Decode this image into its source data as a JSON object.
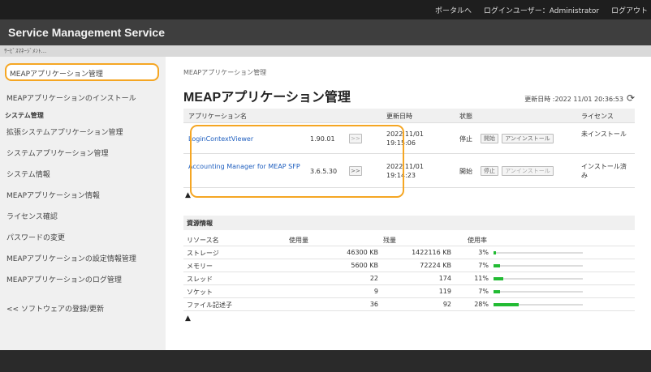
{
  "topbar": {
    "portal_link": "ポータルへ",
    "login_user": "ログインユーザー：Administrator",
    "logout": "ログアウト"
  },
  "header": {
    "app_title": "Service Management Service"
  },
  "crumbbar": {
    "text": "ｻｰﾋﾞｽﾏﾈｰｼﾞﾒﾝﾄ..."
  },
  "sidebar": {
    "items": [
      {
        "label": "MEAPアプリケーション管理"
      },
      {
        "label": "MEAPアプリケーションのインストール"
      },
      {
        "label": "拡張システムアプリケーション管理"
      },
      {
        "label": "システムアプリケーション管理"
      },
      {
        "label": "システム情報"
      },
      {
        "label": "MEAPアプリケーション情報"
      },
      {
        "label": "ライセンス確認"
      },
      {
        "label": "パスワードの変更"
      },
      {
        "label": "MEAPアプリケーションの設定情報管理"
      },
      {
        "label": "MEAPアプリケーションのログ管理"
      },
      {
        "label": "<< ソフトウェアの登録/更新"
      }
    ],
    "section_system": "システム管理"
  },
  "main": {
    "breadcrumb": "MEAPアプリケーション管理",
    "title": "MEAPアプリケーション管理",
    "updated": "更新日時 :2022 11/01 20:36:53",
    "app_table": {
      "headers": [
        "アプリケーション名",
        "更新日時",
        "状態",
        "ライセンス"
      ],
      "rows": [
        {
          "name": "LoginContextViewer",
          "version": "1.90.01",
          "date": "2022 11/01",
          "time": "19:15:06",
          "status": "停止",
          "start": "開始",
          "uninstall": "アンインストール",
          "license": "未インストール"
        },
        {
          "name": "Accounting Manager for MEAP SFP",
          "version": "3.6.5.30",
          "date": "2022 11/01",
          "time": "19:14:23",
          "status": "開始",
          "stop": "停止",
          "uninstall": "アンインストール",
          "license": "インストール済み"
        }
      ],
      "more_button": ">>"
    },
    "resources": {
      "section_title": "資源情報",
      "headers": [
        "リソース名",
        "使用量",
        "残量",
        "使用率"
      ],
      "rows": [
        {
          "name": "ストレージ",
          "used": "46300 KB",
          "remaining": "1422116 KB",
          "rate": "3%",
          "rate_value": 0.03
        },
        {
          "name": "メモリー",
          "used": "5600 KB",
          "remaining": "72224 KB",
          "rate": "7%",
          "rate_value": 0.07
        },
        {
          "name": "スレッド",
          "used": "22",
          "remaining": "174",
          "rate": "11%",
          "rate_value": 0.11
        },
        {
          "name": "ソケット",
          "used": "9",
          "remaining": "119",
          "rate": "7%",
          "rate_value": 0.07
        },
        {
          "name": "ファイル記述子",
          "used": "36",
          "remaining": "92",
          "rate": "28%",
          "rate_value": 0.28
        }
      ]
    }
  },
  "icons": {
    "refresh": "refresh-icon",
    "collapse_up": "collapse-up-icon"
  },
  "colors": {
    "highlight": "#f5a623",
    "usage_bar": "#22bb33",
    "link": "#1f5fbf"
  }
}
